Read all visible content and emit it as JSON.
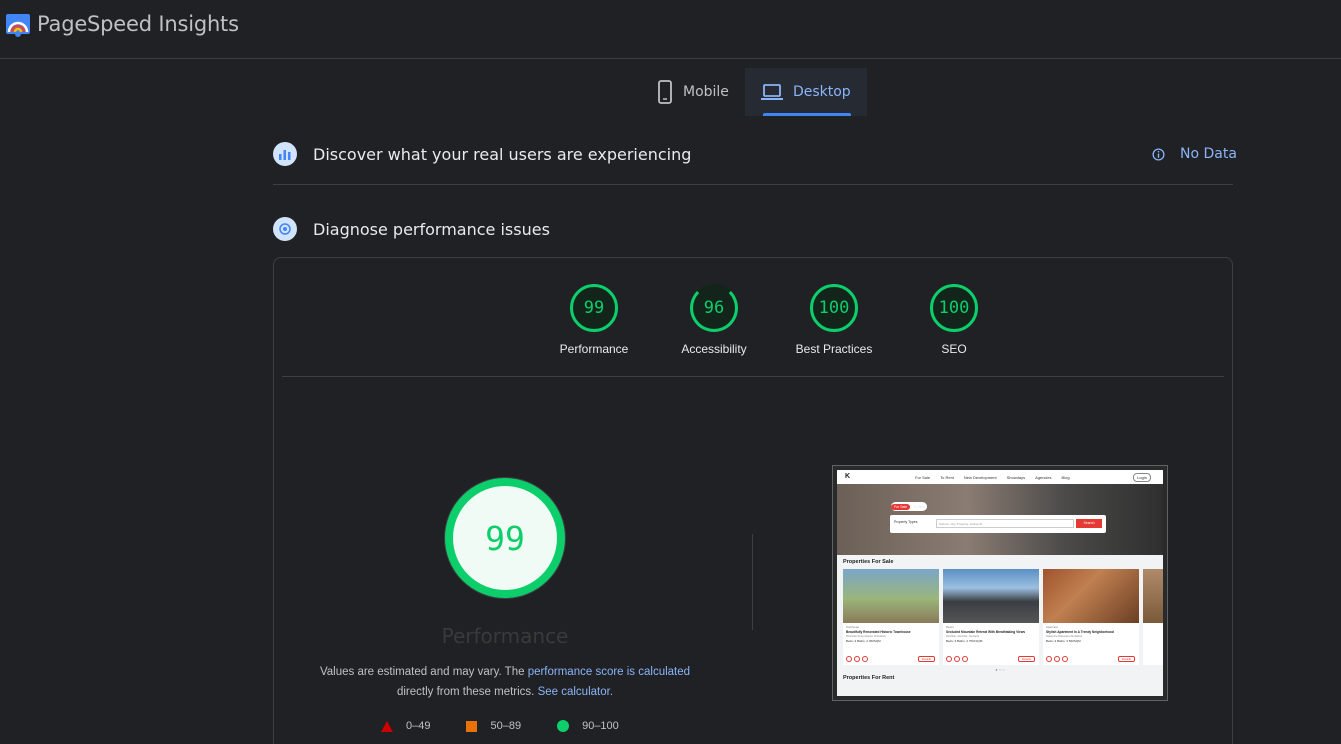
{
  "header": {
    "brand": "PageSpeed Insights",
    "logo_icon": "pagespeed-logo-icon"
  },
  "tabs": [
    {
      "label": "Mobile",
      "icon": "phone-icon",
      "active": false
    },
    {
      "label": "Desktop",
      "icon": "laptop-icon",
      "active": true
    }
  ],
  "field_data": {
    "title": "Discover what your real users are experiencing",
    "status": "No Data",
    "status_icon": "info-icon"
  },
  "lab": {
    "title": "Diagnose performance issues",
    "categories": [
      {
        "label": "Performance",
        "score": "99"
      },
      {
        "label": "Accessibility",
        "score": "96"
      },
      {
        "label": "Best Practices",
        "score": "100"
      },
      {
        "label": "SEO",
        "score": "100"
      }
    ],
    "main_score": "99",
    "main_label": "Performance",
    "note": {
      "text1": "Values are estimated and may vary. The ",
      "link1": "performance score is calculated",
      "text2": "directly from these metrics. ",
      "link2": "See calculator."
    },
    "legend": [
      {
        "label": "0–49",
        "color": "#cc0000",
        "shape": "triangle"
      },
      {
        "label": "50–89",
        "color": "#e8710a",
        "shape": "square"
      },
      {
        "label": "90–100",
        "color": "#0cce6b",
        "shape": "circle"
      }
    ]
  },
  "screenshot": {
    "nav_links": [
      "For Sale",
      "To Rent",
      "New Development",
      "Showdays",
      "Agencies",
      "Blog"
    ],
    "login": "Login",
    "toggle_sale": "For Sale",
    "toggle_rent": "To Rent",
    "property_types": "Property Types",
    "search_placeholder": "Suburb, City, Property, Listing ID",
    "search_btn": "Search",
    "section1": "Properties For Sale",
    "section2": "Properties For Rent",
    "cards": [
      {
        "type": "Townhouse",
        "title": "Beautifully Renovated Historic Townhouse",
        "location": "Riverside Street Harare Zimbabwe",
        "specs": "Beds: 3   Baths: 2   450SQM",
        "details": "Details"
      },
      {
        "type": "Resort",
        "title": "Secluded Mountain Retreat With Breathtaking Views",
        "location": "Zanzibar, Zanzibar, Tanzania",
        "specs": "Beds: 3   Baths: 2   7501SQM",
        "details": "Details"
      },
      {
        "type": "Apartment",
        "title": "Stylish Apartment In A Trendy Neighborhood",
        "location": "Gaborone Botswana Zimbabwe",
        "specs": "Beds: 3   Baths: 3   500SQM",
        "details": "Details"
      }
    ]
  },
  "colors": {
    "good": "#0cce6b",
    "link": "#8ab4f8",
    "accent": "#4285f4"
  }
}
